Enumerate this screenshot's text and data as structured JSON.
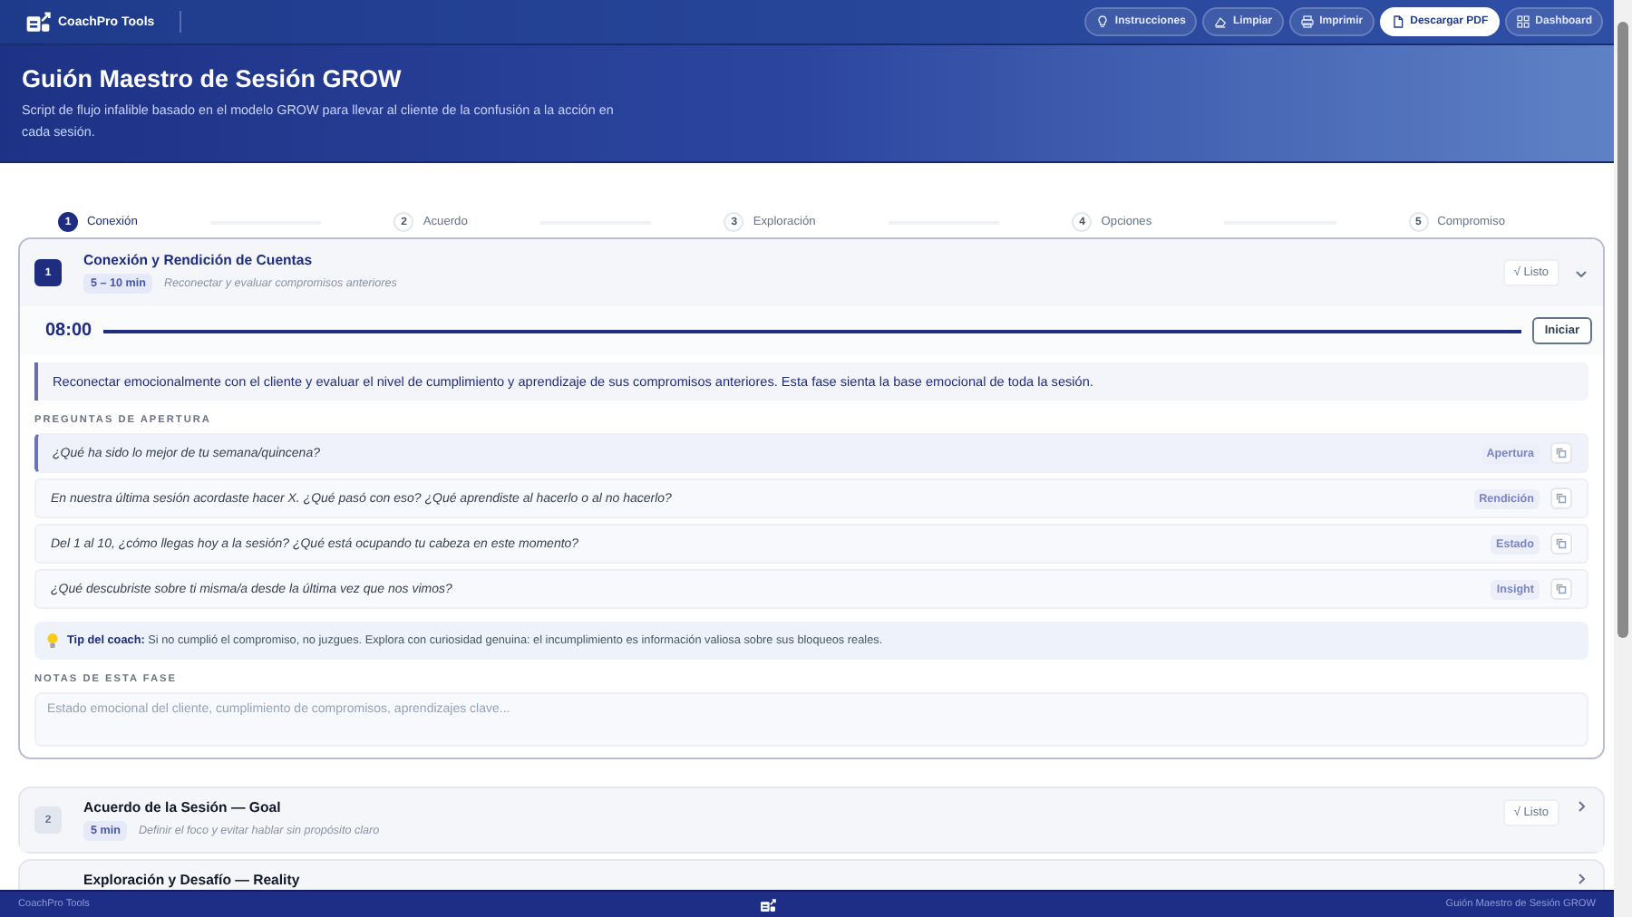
{
  "app": {
    "name": "CoachPro Tools"
  },
  "toolbar": [
    {
      "label": "Instrucciones",
      "primary": false
    },
    {
      "label": "Limpiar",
      "primary": false
    },
    {
      "label": "Imprimir",
      "primary": false
    },
    {
      "label": "Descargar PDF",
      "primary": true
    },
    {
      "label": "Dashboard",
      "primary": false
    }
  ],
  "hero": {
    "title": "Guión Maestro de Sesión GROW",
    "subtitle": "Script de flujo infalible basado en el modelo GROW para llevar al cliente de la confusión a la acción en cada sesión."
  },
  "steps": [
    {
      "number": "1",
      "label": "Conexión",
      "selected": true
    },
    {
      "number": "2",
      "label": "Acuerdo",
      "selected": false
    },
    {
      "number": "3",
      "label": "Exploración",
      "selected": false
    },
    {
      "number": "4",
      "label": "Opciones",
      "selected": false
    },
    {
      "number": "5",
      "label": "Compromiso",
      "selected": false
    }
  ],
  "phases": [
    {
      "number": "1",
      "title": "Conexión y Rendición de Cuentas",
      "duration": "5 – 10 min",
      "subtitle": "Reconectar y evaluar compromisos anteriores",
      "done_label": "√ Listo",
      "expanded": true,
      "timer": {
        "time": "08:00",
        "level": 1,
        "button": "Iniciar"
      },
      "description": "Reconectar emocionalmente con el cliente y evaluar el nivel de cumplimiento y aprendizaje de sus compromisos anteriores. Esta fase sienta la base emocional de toda la sesión.",
      "questions_label": "PREGUNTAS DE APERTURA",
      "questions": [
        {
          "text": "¿Qué ha sido lo mejor de tu semana/quincena?",
          "tag": "Apertura",
          "selected": true
        },
        {
          "text": "En nuestra última sesión acordaste hacer X. ¿Qué pasó con eso? ¿Qué aprendiste al hacerlo o al no hacerlo?",
          "tag": "Rendición",
          "selected": false
        },
        {
          "text": "Del 1 al 10, ¿cómo llegas hoy a la sesión? ¿Qué está ocupando tu cabeza en este momento?",
          "tag": "Estado",
          "selected": false
        },
        {
          "text": "¿Qué descubriste sobre ti misma/a desde la última vez que nos vimos?",
          "tag": "Insight",
          "selected": false
        }
      ],
      "tip": "**Tip del coach:** Si no cumplió el compromiso, no juzgues. Explora con curiosidad genuina: el incumplimiento es información valiosa sobre sus bloqueos reales.",
      "notes_label": "NOTAS DE ESTA FASE",
      "notes_placeholder": "Estado emocional del cliente, cumplimiento de compromisos, aprendizajes clave..."
    },
    {
      "number": "2",
      "title": "Acuerdo de la Sesión — Goal",
      "duration": "5 min",
      "subtitle": "Definir el foco y evitar hablar sin propósito claro",
      "done_label": "√ Listo",
      "expanded": false
    },
    {
      "title": "Exploración y Desafío — Reality",
      "expanded": false
    }
  ],
  "footer": {
    "left": "CoachPro Tools",
    "right": "Guión Maestro de Sesión GROW"
  }
}
